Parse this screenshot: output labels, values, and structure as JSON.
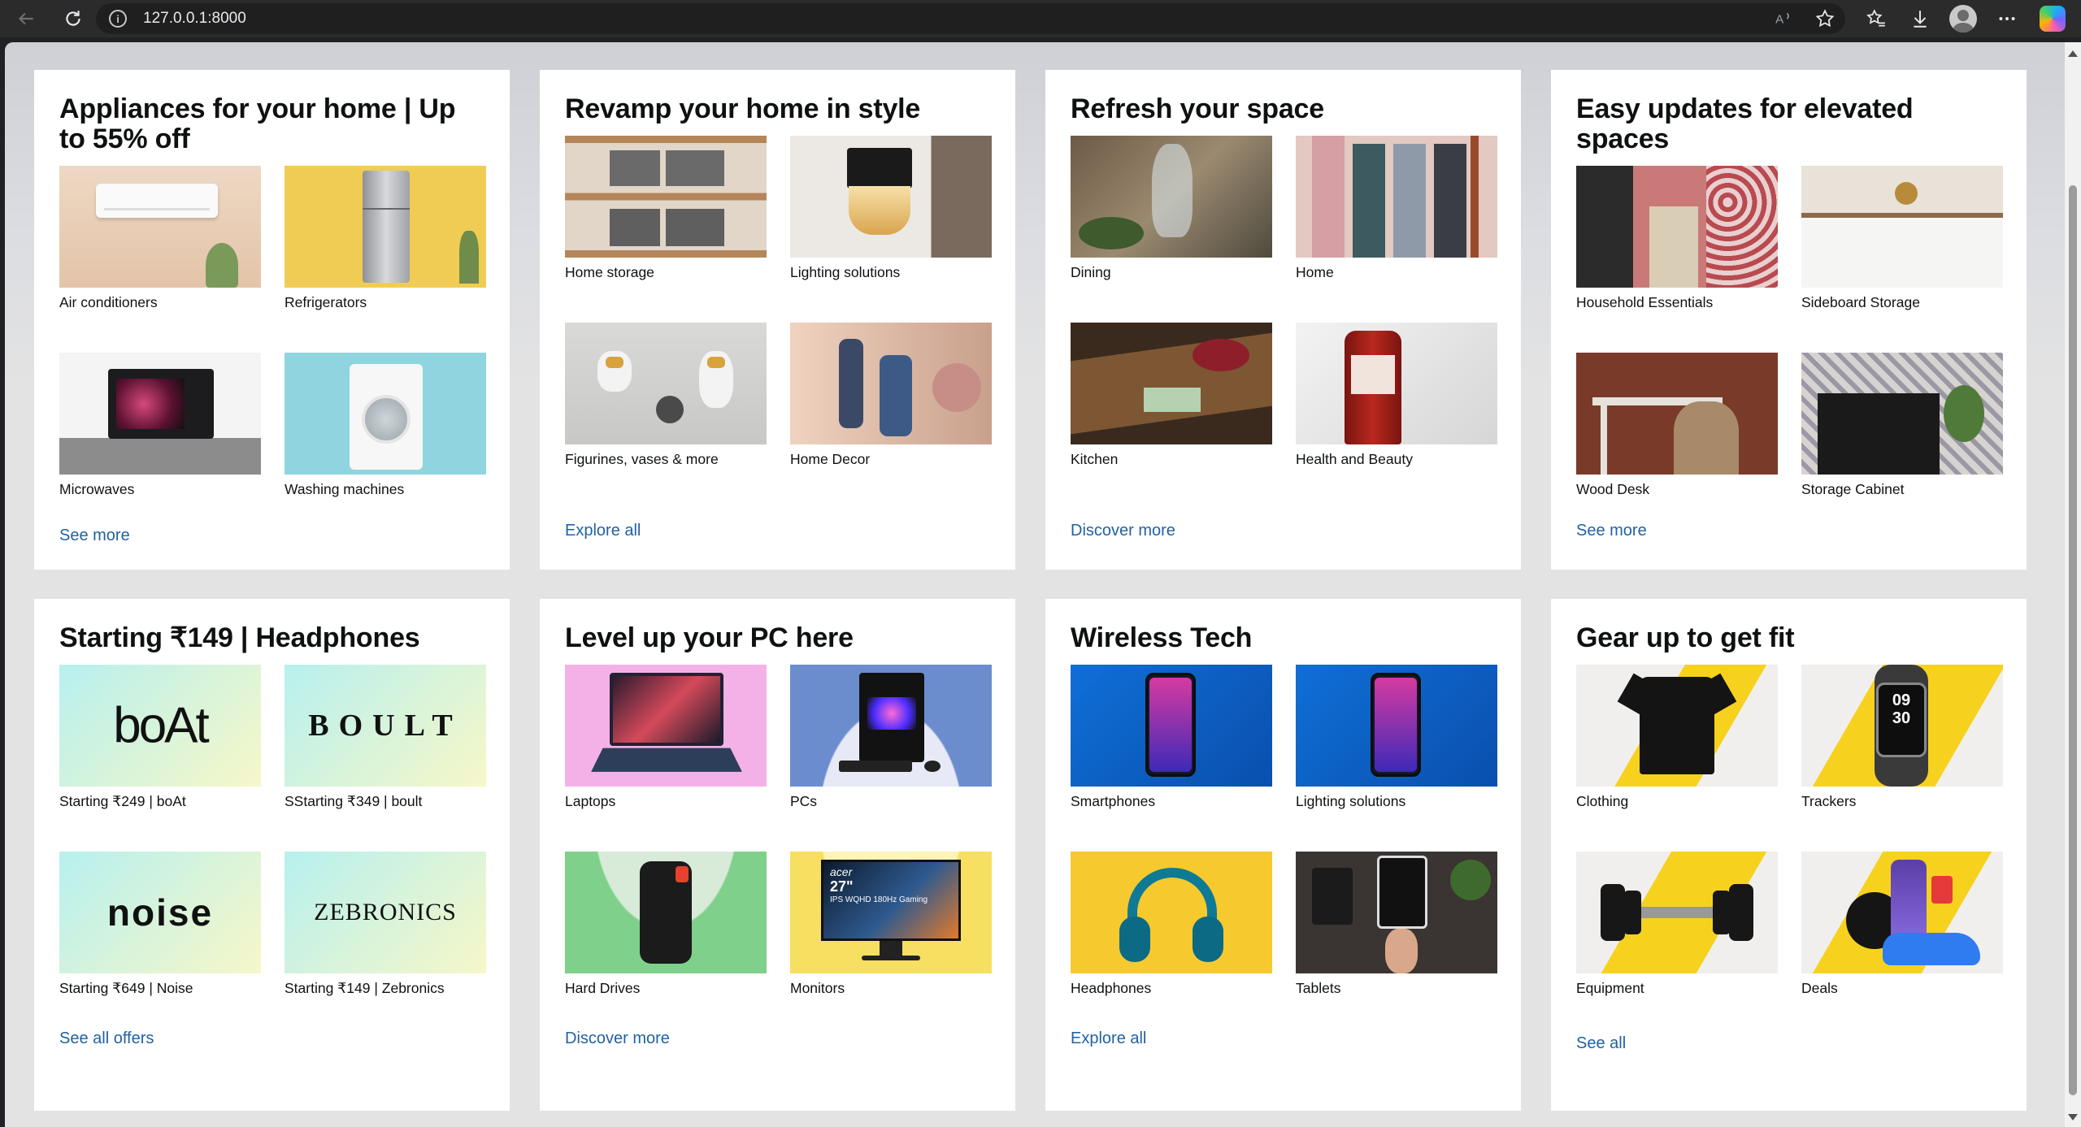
{
  "browser": {
    "url": "127.0.0.1:8000"
  },
  "cards": [
    {
      "title": "Appliances for your home | Up to 55% off",
      "tiles": [
        "Air conditioners",
        "Refrigerators",
        "Microwaves",
        "Washing machines"
      ],
      "link": "See more"
    },
    {
      "title": "Revamp your home in style",
      "tiles": [
        "Home storage",
        "Lighting solutions",
        "Figurines, vases & more",
        "Home Decor"
      ],
      "link": "Explore all"
    },
    {
      "title": "Refresh your space",
      "tiles": [
        "Dining",
        "Home",
        "Kitchen",
        "Health and Beauty"
      ],
      "link": "Discover more"
    },
    {
      "title": "Easy updates for elevated spaces",
      "tiles": [
        "Household Essentials",
        "Sideboard Storage",
        "Wood Desk",
        "Storage Cabinet"
      ],
      "link": "See more"
    },
    {
      "title": "Starting ₹149 | Headphones",
      "tiles": [
        "Starting ₹249 | boAt",
        "SStarting ₹349 | boult",
        "Starting ₹649 | Noise",
        "Starting ₹149 | Zebronics"
      ],
      "logos": [
        "boAt",
        "BOULT",
        "noise",
        "ZEBRONICS"
      ],
      "link": "See all offers"
    },
    {
      "title": "Level up your PC here",
      "tiles": [
        "Laptops",
        "PCs",
        "Hard Drives",
        "Monitors"
      ],
      "monitor_text": [
        "acer",
        "27\"",
        "IPS WQHD 180Hz Gaming"
      ],
      "link": "Discover more"
    },
    {
      "title": "Wireless Tech",
      "tiles": [
        "Smartphones",
        "Lighting solutions",
        "Headphones",
        "Tablets"
      ],
      "link": "Explore all"
    },
    {
      "title": "Gear up to get fit",
      "tiles": [
        "Clothing",
        "Trackers",
        "Equipment",
        "Deals"
      ],
      "tracker_time": [
        "09",
        "30"
      ],
      "link": "See all"
    }
  ],
  "colors": {
    "link": "#2162a1",
    "title": "#0f1111",
    "card_bg": "#ffffff"
  },
  "icons": [
    "back-arrow-icon",
    "reload-icon",
    "site-info-icon",
    "read-aloud-icon",
    "favorite-star-icon",
    "favorites-icon",
    "download-icon",
    "profile-avatar",
    "more-menu-icon",
    "copilot-icon"
  ]
}
